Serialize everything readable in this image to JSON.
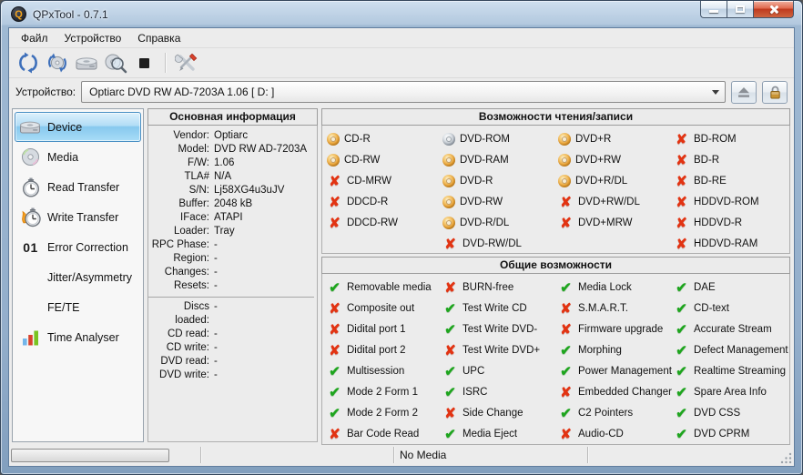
{
  "window": {
    "title": "QPxTool - 0.7.1",
    "app_icon_letter": "Q"
  },
  "menubar": {
    "items": [
      "Файл",
      "Устройство",
      "Справка"
    ]
  },
  "toolbar": {
    "buttons": [
      {
        "name": "rescan-devices",
        "icon": "refresh-arrows-icon"
      },
      {
        "name": "refresh-media",
        "icon": "refresh-disc-icon"
      },
      {
        "name": "drive",
        "icon": "drive-icon"
      },
      {
        "name": "scan-media",
        "icon": "magnifier-disc-icon"
      },
      {
        "name": "stop",
        "icon": "stop-square-icon"
      },
      {
        "name": "preferences",
        "icon": "crossed-tools-icon"
      }
    ]
  },
  "device_bar": {
    "label": "Устройство:",
    "selected_device": "Optiarc  DVD RW AD-7203A  1.06 [ D: ]"
  },
  "sidebar": {
    "items": [
      {
        "label": "Device",
        "icon": "drive-icon",
        "selected": true
      },
      {
        "label": "Media",
        "icon": "disc-icon",
        "selected": false
      },
      {
        "label": "Read Transfer",
        "icon": "stopwatch-icon",
        "selected": false
      },
      {
        "label": "Write Transfer",
        "icon": "stopwatch-flame-icon",
        "selected": false
      },
      {
        "label": "Error Correction",
        "icon": "digits-01-icon",
        "icon_text": "01",
        "selected": false
      },
      {
        "label": "Jitter/Asymmetry",
        "icon": "none",
        "selected": false
      },
      {
        "label": "FE/TE",
        "icon": "none",
        "selected": false
      },
      {
        "label": "Time Analyser",
        "icon": "bar-chart-icon",
        "selected": false
      }
    ]
  },
  "info": {
    "title": "Основная информация",
    "rows": [
      {
        "label": "Vendor:",
        "value": "Optiarc"
      },
      {
        "label": "Model:",
        "value": "DVD RW AD-7203A"
      },
      {
        "label": "F/W:",
        "value": "1.06"
      },
      {
        "label": "TLA#",
        "value": "N/A"
      },
      {
        "label": "S/N:",
        "value": "Lj58XG4u3uJV"
      },
      {
        "label": "Buffer:",
        "value": "2048 kB"
      },
      {
        "label": "IFace:",
        "value": "ATAPI"
      },
      {
        "label": "Loader:",
        "value": "Tray"
      },
      {
        "label": "RPC Phase:",
        "value": "-"
      },
      {
        "label": "Region:",
        "value": "-"
      },
      {
        "label": "Changes:",
        "value": "-"
      },
      {
        "label": "Resets:",
        "value": "-"
      }
    ],
    "rows2": [
      {
        "label": "Discs loaded:",
        "value": "-"
      },
      {
        "label": "CD read:",
        "value": "-"
      },
      {
        "label": "CD write:",
        "value": "-"
      },
      {
        "label": "DVD read:",
        "value": "-"
      },
      {
        "label": "DVD write:",
        "value": "-"
      }
    ]
  },
  "rw": {
    "title": "Возможности чтения/записи",
    "columns": [
      [
        {
          "label": "CD-R",
          "status": "disc"
        },
        {
          "label": "CD-RW",
          "status": "disc"
        },
        {
          "label": "CD-MRW",
          "status": "no"
        },
        {
          "label": "DDCD-R",
          "status": "no"
        },
        {
          "label": "DDCD-RW",
          "status": "no"
        }
      ],
      [
        {
          "label": "DVD-ROM",
          "status": "disc-ro"
        },
        {
          "label": "DVD-RAM",
          "status": "disc"
        },
        {
          "label": "DVD-R",
          "status": "disc"
        },
        {
          "label": "DVD-RW",
          "status": "disc"
        },
        {
          "label": "DVD-R/DL",
          "status": "disc"
        },
        {
          "label": "DVD-RW/DL",
          "status": "no"
        }
      ],
      [
        {
          "label": "DVD+R",
          "status": "disc"
        },
        {
          "label": "DVD+RW",
          "status": "disc"
        },
        {
          "label": "DVD+R/DL",
          "status": "disc"
        },
        {
          "label": "DVD+RW/DL",
          "status": "no"
        },
        {
          "label": "DVD+MRW",
          "status": "no"
        }
      ],
      [
        {
          "label": "BD-ROM",
          "status": "no"
        },
        {
          "label": "BD-R",
          "status": "no"
        },
        {
          "label": "BD-RE",
          "status": "no"
        },
        {
          "label": "HDDVD-ROM",
          "status": "no"
        },
        {
          "label": "HDDVD-R",
          "status": "no"
        },
        {
          "label": "HDDVD-RAM",
          "status": "no"
        }
      ]
    ]
  },
  "gen": {
    "title": "Общие возможности",
    "columns": [
      [
        {
          "label": "Removable media",
          "status": "yes"
        },
        {
          "label": "Composite out",
          "status": "no"
        },
        {
          "label": "Didital port 1",
          "status": "no"
        },
        {
          "label": "Didital port 2",
          "status": "no"
        },
        {
          "label": "Multisession",
          "status": "yes"
        },
        {
          "label": "Mode 2 Form 1",
          "status": "yes"
        },
        {
          "label": "Mode 2 Form 2",
          "status": "yes"
        },
        {
          "label": "Bar Code Read",
          "status": "no"
        }
      ],
      [
        {
          "label": "BURN-free",
          "status": "no"
        },
        {
          "label": "Test Write CD",
          "status": "yes"
        },
        {
          "label": "Test Write DVD-",
          "status": "yes"
        },
        {
          "label": "Test Write DVD+",
          "status": "no"
        },
        {
          "label": "UPC",
          "status": "yes"
        },
        {
          "label": "ISRC",
          "status": "yes"
        },
        {
          "label": "Side Change",
          "status": "no"
        },
        {
          "label": "Media Eject",
          "status": "yes"
        }
      ],
      [
        {
          "label": "Media Lock",
          "status": "yes"
        },
        {
          "label": "S.M.A.R.T.",
          "status": "no"
        },
        {
          "label": "Firmware upgrade",
          "status": "no"
        },
        {
          "label": "Morphing",
          "status": "yes"
        },
        {
          "label": "Power Management",
          "status": "yes"
        },
        {
          "label": "Embedded Changer",
          "status": "no"
        },
        {
          "label": "C2 Pointers",
          "status": "yes"
        },
        {
          "label": "Audio-CD",
          "status": "no"
        }
      ],
      [
        {
          "label": "DAE",
          "status": "yes"
        },
        {
          "label": "CD-text",
          "status": "yes"
        },
        {
          "label": "Accurate Stream",
          "status": "yes"
        },
        {
          "label": "Defect Management",
          "status": "yes"
        },
        {
          "label": "Realtime Streaming",
          "status": "yes"
        },
        {
          "label": "Spare Area Info",
          "status": "yes"
        },
        {
          "label": "DVD CSS",
          "status": "yes"
        },
        {
          "label": "DVD CPRM",
          "status": "yes"
        }
      ]
    ]
  },
  "statusbar": {
    "progress_percent": 0,
    "media_status": "No Media"
  },
  "colors": {
    "selection_blue": "#87c8ee",
    "check_green": "#1ea51e",
    "cross_red": "#e23312",
    "disc_orange": "#efa93c",
    "disc_gray": "#adb5be",
    "titlebar_blue": "#b2c8de",
    "close_button_red": "#cf4a2d",
    "client_bg": "#ececec"
  }
}
